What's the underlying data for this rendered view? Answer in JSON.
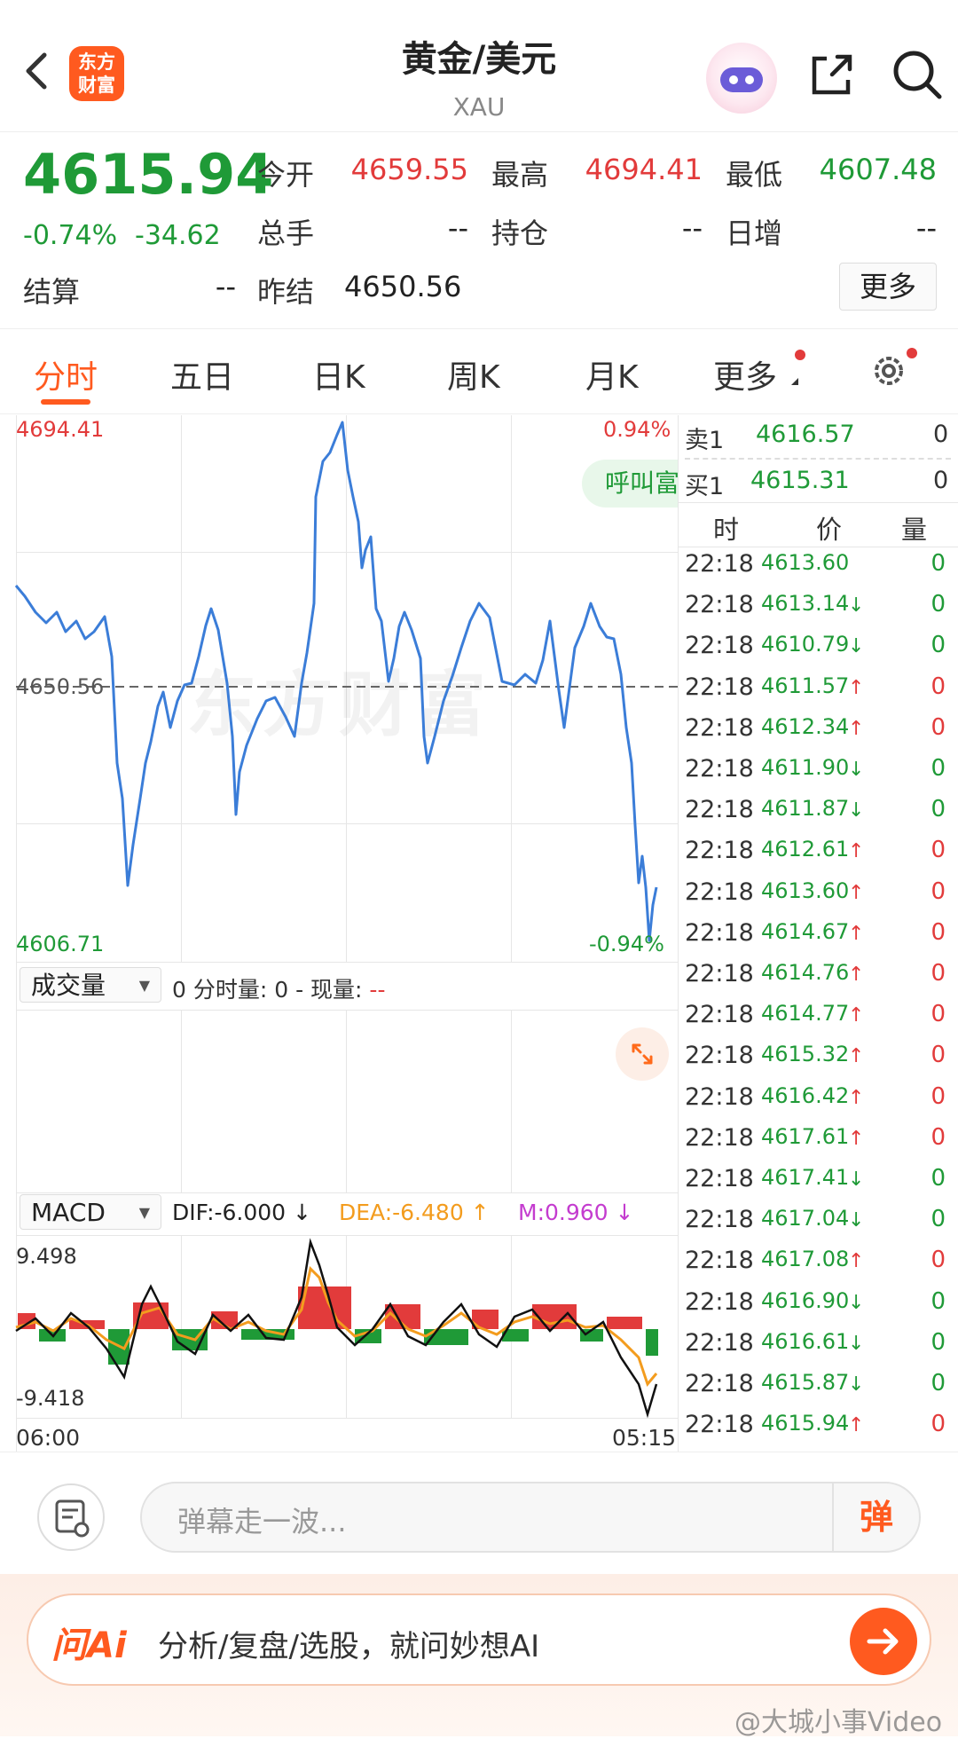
{
  "header": {
    "title": "黄金/美元",
    "subtitle": "XAU",
    "logo_text": "东方财富"
  },
  "quote": {
    "price": "4615.94",
    "change_pct": "-0.74%",
    "change": "-34.62",
    "open_label": "今开",
    "open": "4659.55",
    "high_label": "最高",
    "high": "4694.41",
    "low_label": "最低",
    "low": "4607.48",
    "volume_label": "总手",
    "volume": "--",
    "oi_label": "持仓",
    "oi": "--",
    "daily_inc_label": "日增",
    "daily_inc": "--",
    "settle_label": "结算",
    "settle": "--",
    "prev_settle_label": "昨结",
    "prev_settle": "4650.56",
    "more_label": "更多"
  },
  "tabs": [
    "分时",
    "五日",
    "日K",
    "周K",
    "月K",
    "更多"
  ],
  "chart": {
    "y_max": "4694.41",
    "y_ref": "4650.56",
    "y_min": "4606.71",
    "pct_max": "0.94%",
    "pct_min": "-0.94%",
    "call_btn": "呼叫富",
    "watermark": "东方财富",
    "volume_select": "成交量",
    "volume_info": "0 分时量: 0 - 现量: ",
    "volume_info_dash": "--",
    "macd_select": "MACD",
    "dif": "DIF:-6.000 ↓",
    "dea": "DEA:-6.480 ↑",
    "m": "M:0.960 ↓",
    "macd_max": "9.498",
    "macd_min": "-9.418",
    "time_start": "06:00",
    "time_end": "05:15"
  },
  "orderbook": {
    "sell_label": "卖1",
    "sell_price": "4616.57",
    "sell_qty": "0",
    "buy_label": "买1",
    "buy_price": "4615.31",
    "buy_qty": "0",
    "col_time": "时",
    "col_price": "价",
    "col_qty": "量"
  },
  "ticks": [
    {
      "t": "22:18",
      "p": "4613.60",
      "a": "",
      "q": "0",
      "qc": "green"
    },
    {
      "t": "22:18",
      "p": "4613.14",
      "a": "↓",
      "q": "0",
      "qc": "green"
    },
    {
      "t": "22:18",
      "p": "4610.79",
      "a": "↓",
      "q": "0",
      "qc": "green"
    },
    {
      "t": "22:18",
      "p": "4611.57",
      "a": "↑",
      "q": "0",
      "qc": "red"
    },
    {
      "t": "22:18",
      "p": "4612.34",
      "a": "↑",
      "q": "0",
      "qc": "red"
    },
    {
      "t": "22:18",
      "p": "4611.90",
      "a": "↓",
      "q": "0",
      "qc": "green"
    },
    {
      "t": "22:18",
      "p": "4611.87",
      "a": "↓",
      "q": "0",
      "qc": "green"
    },
    {
      "t": "22:18",
      "p": "4612.61",
      "a": "↑",
      "q": "0",
      "qc": "red"
    },
    {
      "t": "22:18",
      "p": "4613.60",
      "a": "↑",
      "q": "0",
      "qc": "red"
    },
    {
      "t": "22:18",
      "p": "4614.67",
      "a": "↑",
      "q": "0",
      "qc": "red"
    },
    {
      "t": "22:18",
      "p": "4614.76",
      "a": "↑",
      "q": "0",
      "qc": "red"
    },
    {
      "t": "22:18",
      "p": "4614.77",
      "a": "↑",
      "q": "0",
      "qc": "red"
    },
    {
      "t": "22:18",
      "p": "4615.32",
      "a": "↑",
      "q": "0",
      "qc": "red"
    },
    {
      "t": "22:18",
      "p": "4616.42",
      "a": "↑",
      "q": "0",
      "qc": "red"
    },
    {
      "t": "22:18",
      "p": "4617.61",
      "a": "↑",
      "q": "0",
      "qc": "red"
    },
    {
      "t": "22:18",
      "p": "4617.41",
      "a": "↓",
      "q": "0",
      "qc": "green"
    },
    {
      "t": "22:18",
      "p": "4617.04",
      "a": "↓",
      "q": "0",
      "qc": "green"
    },
    {
      "t": "22:18",
      "p": "4617.08",
      "a": "↑",
      "q": "0",
      "qc": "red"
    },
    {
      "t": "22:18",
      "p": "4616.90",
      "a": "↓",
      "q": "0",
      "qc": "green"
    },
    {
      "t": "22:18",
      "p": "4616.61",
      "a": "↓",
      "q": "0",
      "qc": "green"
    },
    {
      "t": "22:18",
      "p": "4615.87",
      "a": "↓",
      "q": "0",
      "qc": "green"
    },
    {
      "t": "22:18",
      "p": "4615.94",
      "a": "↑",
      "q": "0",
      "qc": "red"
    }
  ],
  "danmaku": {
    "placeholder": "弹幕走一波...",
    "btn": "弹"
  },
  "ai": {
    "logo": "问Ai",
    "text": "分析/复盘/选股，就问妙想AI"
  },
  "watermark_footer": "@大城小事Video",
  "colors": {
    "up": "#e23b3b",
    "down": "#1f9a37",
    "line": "#3b7dd8",
    "accent": "#ff6a1a"
  }
}
